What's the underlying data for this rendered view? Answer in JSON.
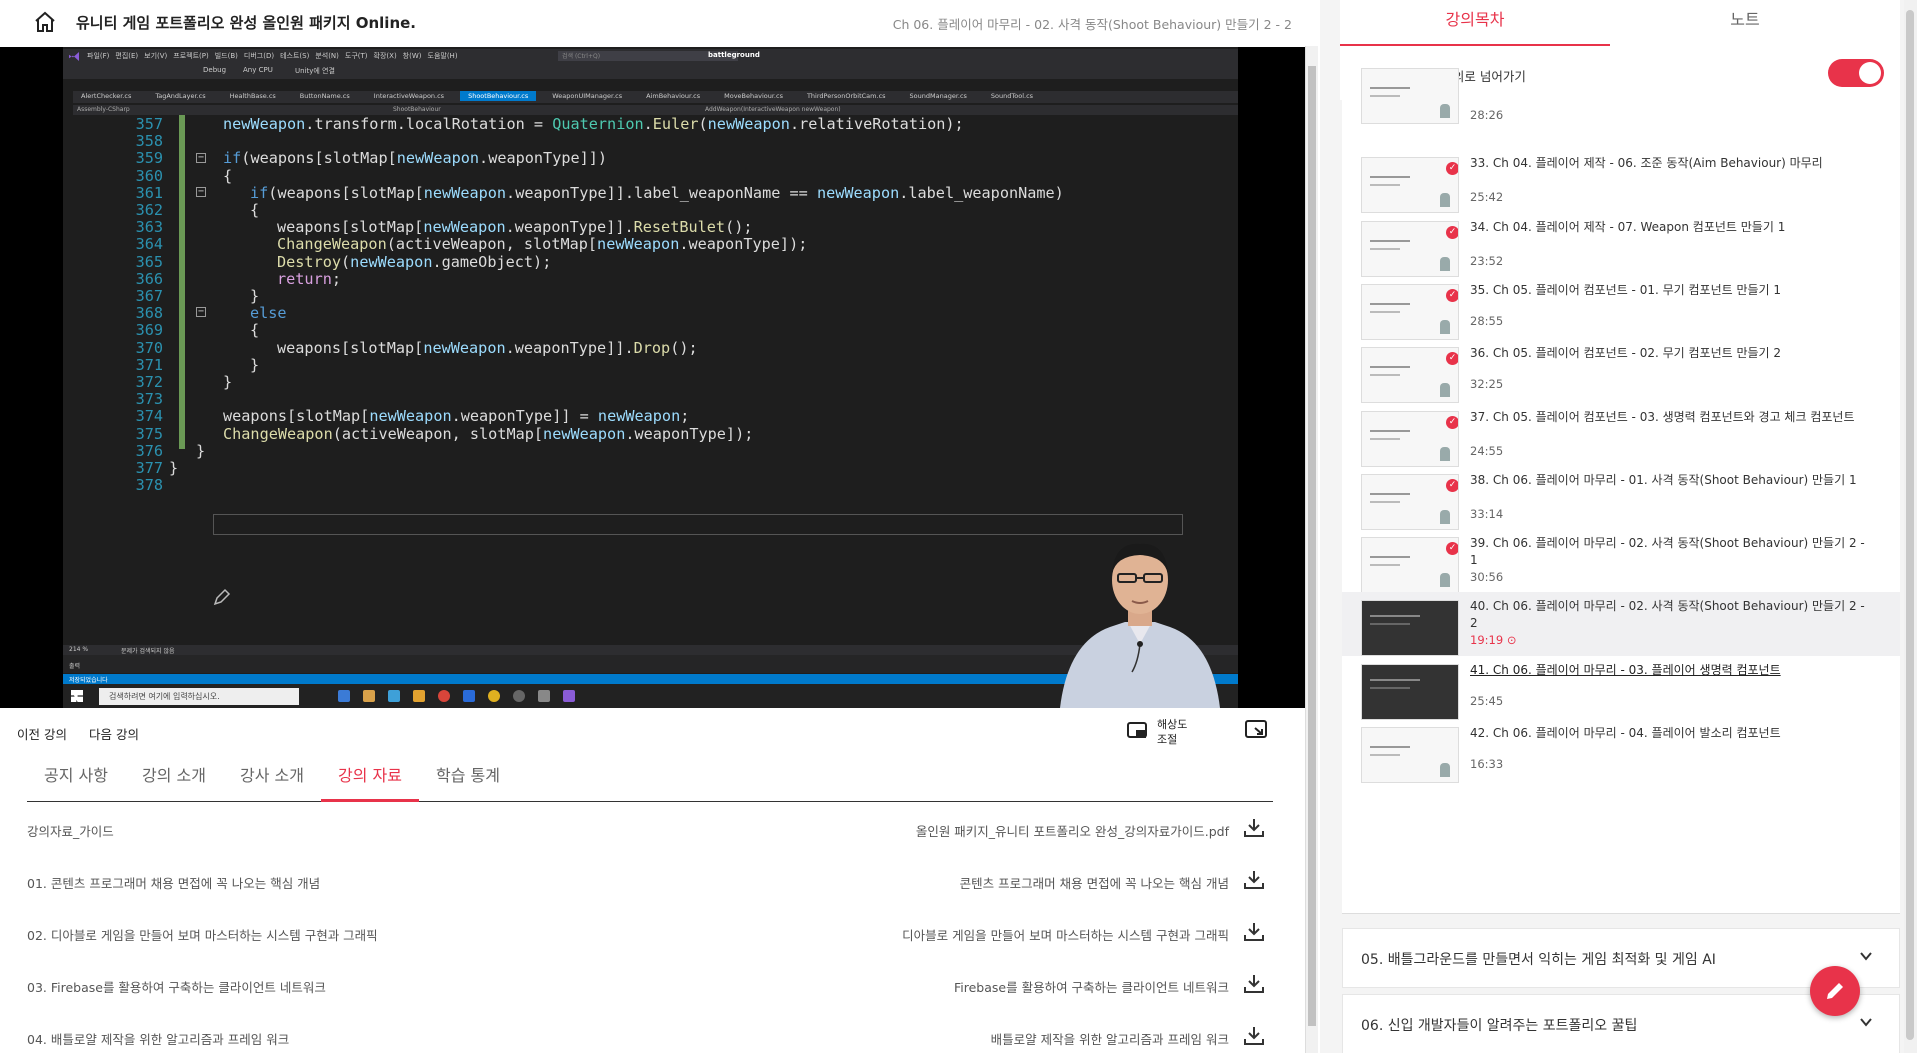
{
  "header": {
    "course_title": "유니티 게임 포트폴리오 완성 올인원 패키지 Online.",
    "lecture_title": "Ch 06. 플레이어 마무리 - 02. 사격 동작(Shoot Behaviour) 만들기 2 - 2"
  },
  "video": {
    "progress": 0.43,
    "ide": {
      "menu": [
        "파일(F)",
        "편집(E)",
        "보기(V)",
        "프로젝트(P)",
        "빌드(B)",
        "디버그(D)",
        "테스트(S)",
        "분석(N)",
        "도구(T)",
        "확장(X)",
        "창(W)",
        "도움말(H)"
      ],
      "search_placeholder": "검색 (Ctrl+Q)",
      "project": "battleground",
      "toolbar_items": [
        "Debug",
        "Any CPU",
        "Unity에 연결"
      ],
      "tabs": [
        "AlertChecker.cs",
        "TagAndLayer.cs",
        "HealthBase.cs",
        "ButtonName.cs",
        "InteractiveWeapon.cs",
        "ShootBehaviour.cs",
        "WeaponUIManager.cs",
        "AimBehaviour.cs",
        "MoveBehaviour.cs",
        "ThirdPersonOrbitCam.cs",
        "SoundManager.cs",
        "SoundTool.cs"
      ],
      "active_tab_index": 5,
      "nav_left": "Assembly-CSharp",
      "nav_mid": "ShootBehaviour",
      "nav_right": "AddWeapon(InteractiveWeapon newWeapon)",
      "zoom": "214 %",
      "status_msg": "문제가 검색되지 않음",
      "output_label": "출력",
      "saved_msg": "저장되었습니다",
      "taskbar_search": "검색하려면 여기에 입력하십시오."
    },
    "code_lines": [
      {
        "n": "357",
        "indent": 2,
        "code": "newWeapon.transform.localRotation = Quaternion.Euler(newWeapon.relativeRotation);"
      },
      {
        "n": "358",
        "indent": 0,
        "code": ""
      },
      {
        "n": "359",
        "indent": 2,
        "code": "if(weapons[slotMap[newWeapon.weaponType]])"
      },
      {
        "n": "360",
        "indent": 2,
        "code": "{"
      },
      {
        "n": "361",
        "indent": 3,
        "code": "if(weapons[slotMap[newWeapon.weaponType]].label_weaponName == newWeapon.label_weaponName)"
      },
      {
        "n": "362",
        "indent": 3,
        "code": "{"
      },
      {
        "n": "363",
        "indent": 4,
        "code": "weapons[slotMap[newWeapon.weaponType]].ResetBulet();"
      },
      {
        "n": "364",
        "indent": 4,
        "code": "ChangeWeapon(activeWeapon, slotMap[newWeapon.weaponType]);"
      },
      {
        "n": "365",
        "indent": 4,
        "code": "Destroy(newWeapon.gameObject);"
      },
      {
        "n": "366",
        "indent": 4,
        "code": "return;"
      },
      {
        "n": "367",
        "indent": 3,
        "code": "}"
      },
      {
        "n": "368",
        "indent": 3,
        "code": "else"
      },
      {
        "n": "369",
        "indent": 3,
        "code": "{"
      },
      {
        "n": "370",
        "indent": 4,
        "code": "weapons[slotMap[newWeapon.weaponType]].Drop();"
      },
      {
        "n": "371",
        "indent": 3,
        "code": "}"
      },
      {
        "n": "372",
        "indent": 2,
        "code": "}"
      },
      {
        "n": "373",
        "indent": 0,
        "code": ""
      },
      {
        "n": "374",
        "indent": 2,
        "code": "weapons[slotMap[newWeapon.weaponType]] = newWeapon;"
      },
      {
        "n": "375",
        "indent": 2,
        "code": "ChangeWeapon(activeWeapon, slotMap[newWeapon.weaponType]);"
      },
      {
        "n": "376",
        "indent": 1,
        "code": "}"
      },
      {
        "n": "377",
        "indent": 0,
        "code": "}"
      },
      {
        "n": "378",
        "indent": 0,
        "code": ""
      }
    ]
  },
  "controls": {
    "prev": "이전 강의",
    "next": "다음 강의",
    "resolution": "해상도 조절"
  },
  "tabs": [
    "공지 사항",
    "강의 소개",
    "강사 소개",
    "강의 자료",
    "학습 통계"
  ],
  "active_tab": 3,
  "files": [
    {
      "left": "강의자료_가이드",
      "right": "올인원 패키지_유니티 포트폴리오 완성_강의자료가이드.pdf"
    },
    {
      "left": "01. 콘텐츠 프로그래머 채용 면접에 꼭 나오는 핵심 개념",
      "right": "콘텐츠 프로그래머 채용 면접에 꼭 나오는 핵심 개념"
    },
    {
      "left": "02. 디아블로 게임을 만들어 보며 마스터하는 시스템 구현과 그래픽",
      "right": "디아블로 게임을 만들어 보며 마스터하는 시스템 구현과 그래픽"
    },
    {
      "left": "03. Firebase를 활용하여 구축하는 클라이언트 네트워크",
      "right": "Firebase를 활용하여 구축하는 클라이언트 네트워크"
    },
    {
      "left": "04. 배틀로얄 제작을 위한 알고리즘과 프레임 워크",
      "right": "배틀로얄 제작을 위한 알고리즘과 프레임 워크"
    }
  ],
  "sidebar": {
    "tabs": [
      "강의목차",
      "노트"
    ],
    "autoplay_label": "완강 시 다음 강의로 넘어가기",
    "autoplay_on": true,
    "lectures": [
      {
        "title": "",
        "duration": "28:26",
        "done": false,
        "current": false,
        "thumb": "light"
      },
      {
        "title": "33. Ch 04. 플레이어 제작 - 06. 조준 동작(Aim Behaviour) 마무리",
        "duration": "25:42",
        "done": true,
        "current": false,
        "thumb": "light"
      },
      {
        "title": "34. Ch 04. 플레이어 제작 - 07. Weapon 컴포넌트 만들기 1",
        "duration": "23:52",
        "done": true,
        "current": false,
        "thumb": "light"
      },
      {
        "title": "35. Ch 05. 플레이어 컴포넌트 - 01. 무기 컴포넌트 만들기 1",
        "duration": "28:55",
        "done": true,
        "current": false,
        "thumb": "light"
      },
      {
        "title": "36. Ch 05. 플레이어 컴포넌트 - 02. 무기 컴포넌트 만들기 2",
        "duration": "32:25",
        "done": true,
        "current": false,
        "thumb": "light"
      },
      {
        "title": "37. Ch 05. 플레이어 컴포넌트 - 03. 생명력 컴포넌트와 경고 체크 컴포넌트",
        "duration": "24:55",
        "done": true,
        "current": false,
        "thumb": "light"
      },
      {
        "title": "38. Ch 06. 플레이어 마무리 - 01. 사격 동작(Shoot Behaviour) 만들기 1",
        "duration": "33:14",
        "done": true,
        "current": false,
        "thumb": "light"
      },
      {
        "title": "39. Ch 06. 플레이어 마무리 - 02. 사격 동작(Shoot Behaviour) 만들기 2 - 1",
        "duration": "30:56",
        "done": true,
        "current": false,
        "thumb": "light"
      },
      {
        "title": "40. Ch 06. 플레이어 마무리 - 02. 사격 동작(Shoot Behaviour) 만들기 2 - 2",
        "duration": "19:19",
        "done": false,
        "current": true,
        "thumb": "dark"
      },
      {
        "title": "41. Ch 06. 플레이어 마무리 - 03. 플레이어 생명력 컴포넌트",
        "duration": "25:45",
        "done": false,
        "current": false,
        "thumb": "dark",
        "link": true
      },
      {
        "title": "42. Ch 06. 플레이어 마무리 - 04. 플레이어 발소리 컴포넌트",
        "duration": "16:33",
        "done": false,
        "current": false,
        "thumb": "light"
      }
    ],
    "sections": [
      "05. 배틀그라운드를 만들면서 익히는 게임 최적화 및 게임 AI",
      "06. 신입 개발자들이 알려주는 포트폴리오 꿀팁"
    ]
  },
  "colors": {
    "accent": "#e8334a",
    "code_bg": "#1e1e1e",
    "keyword": "#569cd6",
    "type": "#4ec9b0",
    "param": "#9cdcfe"
  }
}
